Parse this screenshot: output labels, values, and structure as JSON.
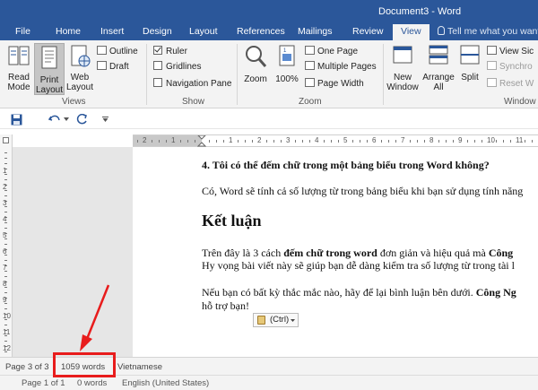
{
  "window": {
    "title": "Document3 - Word"
  },
  "tabs": [
    "File",
    "Home",
    "Insert",
    "Design",
    "Layout",
    "References",
    "Mailings",
    "Review",
    "View"
  ],
  "active_tab": "View",
  "tell_me": "Tell me what you want to do",
  "ribbon": {
    "views": {
      "label": "Views",
      "read_mode": [
        "Read",
        "Mode"
      ],
      "print_layout": [
        "Print",
        "Layout"
      ],
      "web_layout": [
        "Web",
        "Layout"
      ],
      "outline": "Outline",
      "draft": "Draft"
    },
    "show": {
      "label": "Show",
      "ruler": "Ruler",
      "gridlines": "Gridlines",
      "navigation_pane": "Navigation Pane"
    },
    "zoom": {
      "label": "Zoom",
      "zoom": "Zoom",
      "hundred": "100%",
      "one_page": "One Page",
      "multiple_pages": "Multiple Pages",
      "page_width": "Page Width"
    },
    "window": {
      "label": "Window",
      "new_window": [
        "New",
        "Window"
      ],
      "arrange_all": [
        "Arrange",
        "All"
      ],
      "split": "Split",
      "view_side": "View Sic",
      "synchro": "Synchro",
      "reset_w": "Reset W"
    }
  },
  "ruler": {
    "h_numbers": [
      "2",
      "1",
      "1",
      "2",
      "3",
      "4",
      "5",
      "6",
      "7",
      "8",
      "9",
      "10",
      "11",
      "12"
    ],
    "v_numbers": [
      "1",
      "2",
      "3",
      "4",
      "5",
      "6",
      "7",
      "8",
      "9",
      "10",
      "11",
      "12"
    ]
  },
  "document": {
    "q4": "4. Tôi có thể đếm chữ trong một bảng biểu trong Word không?",
    "answer": "Có, Word sẽ tính cả số lượng từ trong bảng biểu khi bạn sử dụng tính năng",
    "heading": "Kết luận",
    "p1_a": "Trên đây là 3 cách ",
    "p1_b": "đếm chữ trong word",
    "p1_c": " đơn giản và hiệu quả mà ",
    "p1_d": "Công",
    "p2": "Hy vọng bài viết này sẽ giúp bạn dễ dàng kiểm tra số lượng từ trong tài l",
    "p3_a": "Nếu bạn có bất kỳ thắc mắc nào, hãy để lại bình luận bên dưới. ",
    "p3_b": "Công Ng",
    "p4": "hỗ trợ bạn!",
    "paste_options": "(Ctrl)"
  },
  "status": {
    "page": "Page 3 of 3",
    "words": "1059 words",
    "language": "Vietnamese"
  },
  "status2": {
    "page": "Page 1 of 1",
    "words": "0 words",
    "language": "English (United States)"
  },
  "colors": {
    "title_bar": "#2b579a",
    "annotation": "#e81c1c"
  }
}
